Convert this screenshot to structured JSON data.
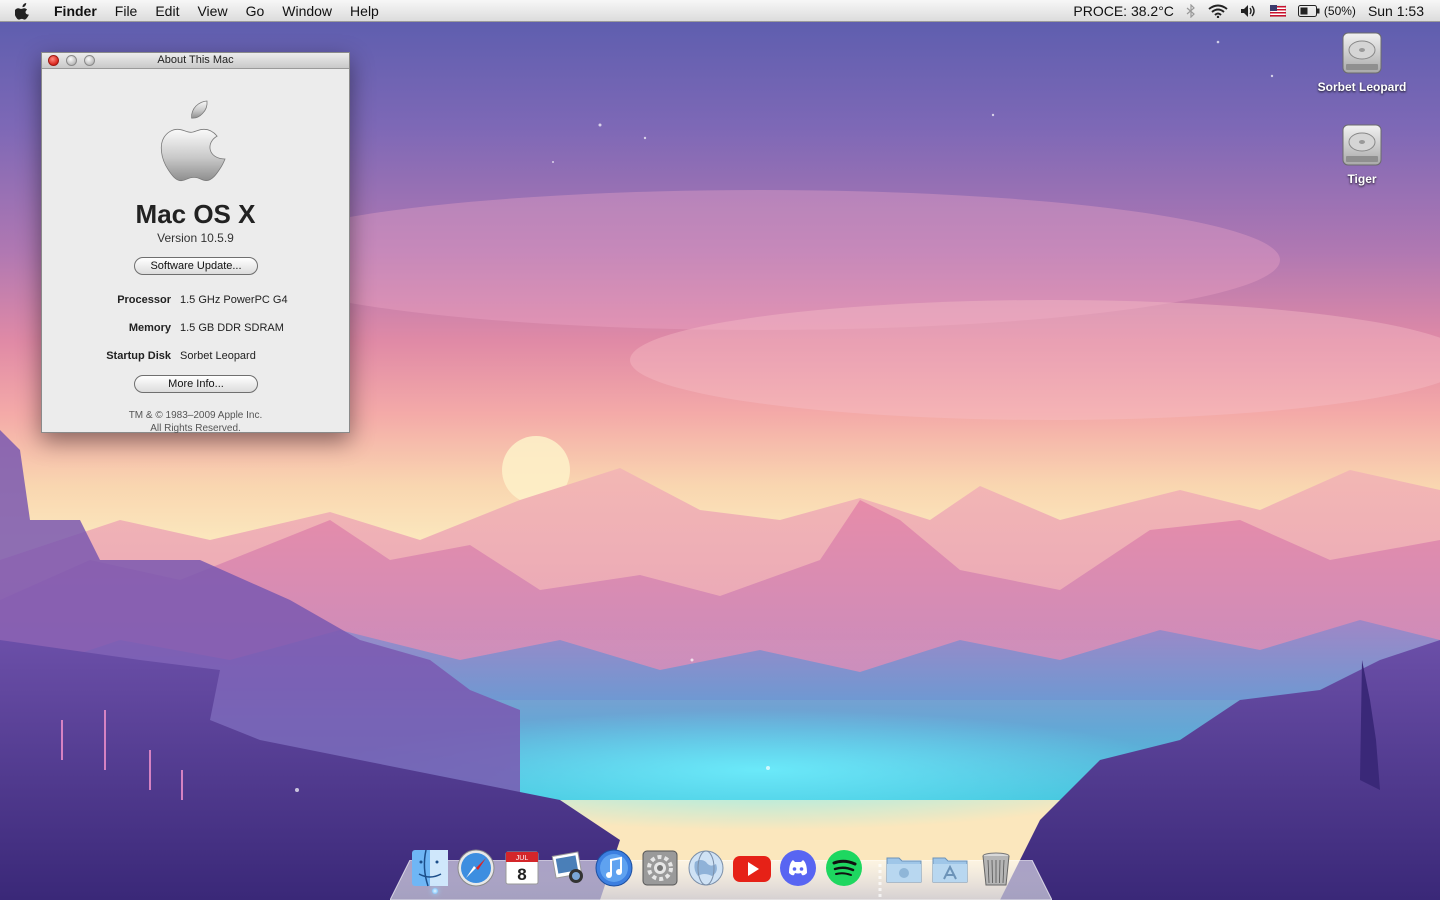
{
  "menubar": {
    "app_name": "Finder",
    "menus": [
      "File",
      "Edit",
      "View",
      "Go",
      "Window",
      "Help"
    ],
    "status": {
      "cpu_temp": "PROCE: 38.2°C",
      "battery_percent": "(50%)",
      "clock": "Sun 1:53"
    },
    "icons": [
      "apple-icon",
      "bluetooth-icon",
      "wifi-icon",
      "volume-icon",
      "input-flag-icon",
      "battery-icon"
    ]
  },
  "desktop": {
    "icons": [
      {
        "label": "Sorbet Leopard",
        "icon": "hard-drive-icon"
      },
      {
        "label": "Tiger",
        "icon": "hard-drive-icon"
      }
    ]
  },
  "about_window": {
    "title": "About This Mac",
    "os_name": "Mac OS X",
    "version": "Version 10.5.9",
    "software_update_label": "Software Update...",
    "specs": [
      {
        "label": "Processor",
        "value": "1.5 GHz PowerPC G4"
      },
      {
        "label": "Memory",
        "value": "1.5 GB DDR SDRAM"
      },
      {
        "label": "Startup Disk",
        "value": "Sorbet Leopard"
      }
    ],
    "more_info_label": "More Info...",
    "copyright_line1": "TM & © 1983–2009 Apple Inc.",
    "copyright_line2": "All Rights Reserved."
  },
  "dock": {
    "items": [
      "finder-icon",
      "safari-icon",
      "ical-icon",
      "iphoto-icon",
      "itunes-icon",
      "system-preferences-icon",
      "network-globe-icon",
      "youtube-icon",
      "discord-icon",
      "spotify-icon",
      "documents-stack-icon",
      "applications-stack-icon",
      "trash-icon"
    ],
    "ical_day": "8",
    "ical_month": "JUL"
  },
  "colors": {
    "youtube": "#e62117",
    "discord": "#5865f2",
    "spotify": "#1ed760",
    "close_button": "#d9231b"
  }
}
